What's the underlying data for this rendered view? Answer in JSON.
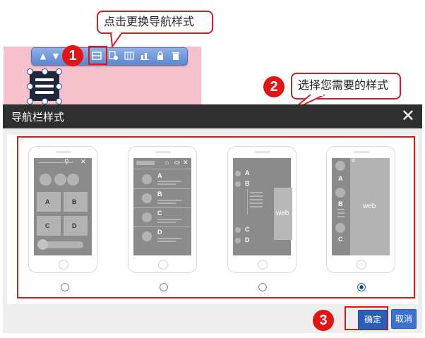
{
  "annotations": {
    "step1_number": "1",
    "step1_text": "点击更换导航样式",
    "step2_number": "2",
    "step2_text": "选择您需要的样式",
    "step3_number": "3"
  },
  "toolbar": {
    "icons": [
      "chevron-up-icon",
      "chevron-down-icon",
      "nav-style-icon",
      "settings-icon",
      "sliders-icon",
      "chart-icon",
      "lock-icon",
      "trash-icon"
    ]
  },
  "modal": {
    "title": "导航栏样式",
    "close_glyph": "✕",
    "ok_label": "确定",
    "cancel_label": "取消",
    "selected_option": 4
  },
  "options": {
    "style1": {
      "cells": [
        "A",
        "B",
        "C",
        "D"
      ]
    },
    "style2": {
      "items": [
        "A",
        "B",
        "C",
        "D"
      ]
    },
    "style3": {
      "items": [
        "A",
        "B",
        "C",
        "D"
      ],
      "side_label": "web"
    },
    "style4": {
      "items": [
        "A",
        "B",
        "C"
      ],
      "side_label": "web"
    }
  },
  "colors": {
    "accent_red": "#e31414",
    "modal_header": "#2f2f2f",
    "button_blue": "#2b5eb8",
    "pink_bg": "#f6c0cc"
  }
}
